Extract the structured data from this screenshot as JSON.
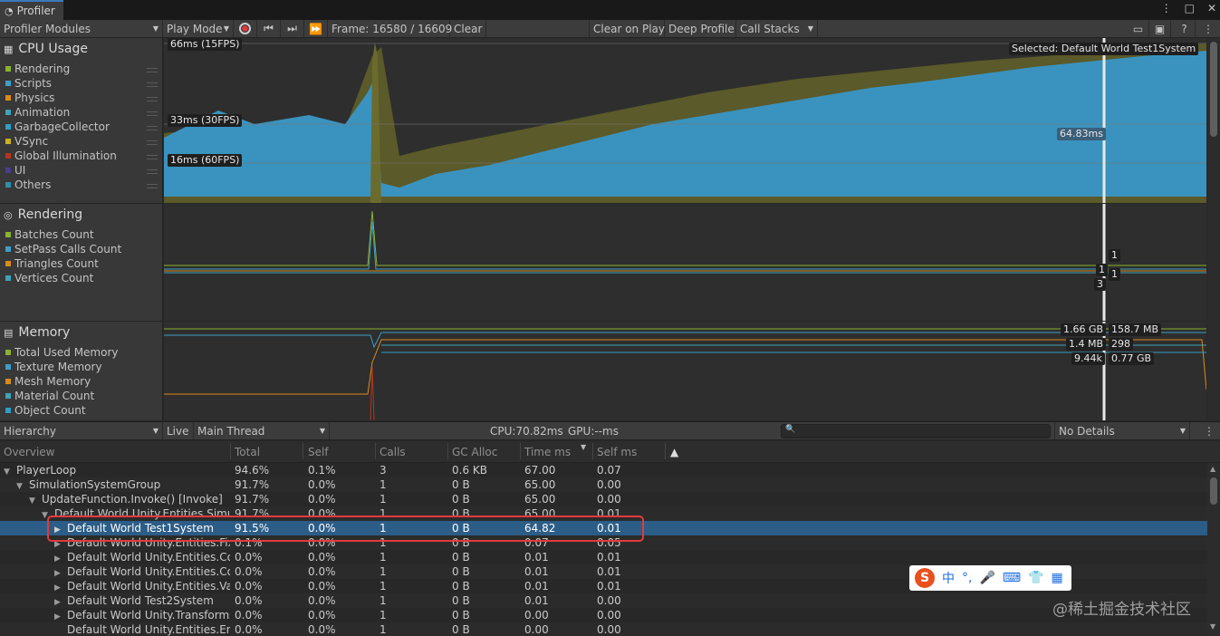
{
  "window": {
    "tab_title": "Profiler"
  },
  "toolbar": {
    "modules_label": "Profiler Modules",
    "play_mode_label": "Play Mode",
    "frame_label": "Frame: 16580 / 16609",
    "clear_label": "Clear",
    "clear_on_play_label": "Clear on Play",
    "deep_profile_label": "Deep Profile",
    "call_stacks_label": "Call Stacks"
  },
  "modules": [
    {
      "title": "CPU Usage",
      "items": [
        {
          "label": "Rendering",
          "color": "#8bb22e"
        },
        {
          "label": "Scripts",
          "color": "#3e9ec7"
        },
        {
          "label": "Physics",
          "color": "#d98b1a"
        },
        {
          "label": "Animation",
          "color": "#3ea3b8"
        },
        {
          "label": "GarbageCollector",
          "color": "#2e9ec4"
        },
        {
          "label": "VSync",
          "color": "#c8b21f"
        },
        {
          "label": "Global Illumination",
          "color": "#b5341f"
        },
        {
          "label": "UI",
          "color": "#4a3d8f"
        },
        {
          "label": "Others",
          "color": "#2f8fa8"
        }
      ]
    },
    {
      "title": "Rendering",
      "items": [
        {
          "label": "Batches Count",
          "color": "#8bb22e"
        },
        {
          "label": "SetPass Calls Count",
          "color": "#3e9ec7"
        },
        {
          "label": "Triangles Count",
          "color": "#d98b1a"
        },
        {
          "label": "Vertices Count",
          "color": "#3ea3b8"
        }
      ]
    },
    {
      "title": "Memory",
      "items": [
        {
          "label": "Total Used Memory",
          "color": "#8bb22e"
        },
        {
          "label": "Texture Memory",
          "color": "#3e9ec7"
        },
        {
          "label": "Mesh Memory",
          "color": "#d98b1a"
        },
        {
          "label": "Material Count",
          "color": "#3ea3b8"
        },
        {
          "label": "Object Count",
          "color": "#2e9ec4"
        }
      ]
    }
  ],
  "cpu_chart": {
    "label_66": "66ms (15FPS)",
    "label_33": "33ms (30FPS)",
    "label_16": "16ms (60FPS)",
    "selected_label": "Selected: Default World Test1System",
    "value_label": "64.83ms"
  },
  "render_chart": {
    "v1": "1",
    "v2": "1",
    "v3": "1",
    "v4": "3"
  },
  "memory_chart": {
    "l1": "1.66 GB",
    "l2": "1.4 MB",
    "l3": "9.44k",
    "r1": "158.7 MB",
    "r2": "298",
    "r3": "0.77 GB"
  },
  "hierarchy": {
    "view_label": "Hierarchy",
    "live_label": "Live",
    "thread_label": "Main Thread",
    "cpu_label": "CPU:70.82ms",
    "gpu_label": "GPU:--ms",
    "details_label": "No Details",
    "columns": [
      "Overview",
      "Total",
      "Self",
      "Calls",
      "GC Alloc",
      "Time ms",
      "Self ms"
    ],
    "rows": [
      {
        "name": "PlayerLoop",
        "indent": 0,
        "arrow": "▼",
        "total": "94.6%",
        "self": "0.1%",
        "calls": "3",
        "gc": "0.6 KB",
        "time": "67.00",
        "selfms": "0.07"
      },
      {
        "name": "SimulationSystemGroup",
        "indent": 1,
        "arrow": "▼",
        "total": "91.7%",
        "self": "0.0%",
        "calls": "1",
        "gc": "0 B",
        "time": "65.00",
        "selfms": "0.00"
      },
      {
        "name": "UpdateFunction.Invoke() [Invoke]",
        "indent": 2,
        "arrow": "▼",
        "total": "91.7%",
        "self": "0.0%",
        "calls": "1",
        "gc": "0 B",
        "time": "65.00",
        "selfms": "0.00"
      },
      {
        "name": "Default World Unity.Entities.Simula",
        "indent": 3,
        "arrow": "▼",
        "total": "91.7%",
        "self": "0.0%",
        "calls": "1",
        "gc": "0 B",
        "time": "65.00",
        "selfms": "0.01"
      },
      {
        "name": "Default World Test1System",
        "indent": 4,
        "arrow": "▶",
        "total": "91.5%",
        "self": "0.0%",
        "calls": "1",
        "gc": "0 B",
        "time": "64.82",
        "selfms": "0.01",
        "selected": true
      },
      {
        "name": "Default World Unity.Entities.Fixe",
        "indent": 4,
        "arrow": "▶",
        "total": "0.1%",
        "self": "0.0%",
        "calls": "1",
        "gc": "0 B",
        "time": "0.07",
        "selfms": "0.05"
      },
      {
        "name": "Default World Unity.Entities.Con",
        "indent": 4,
        "arrow": "▶",
        "total": "0.0%",
        "self": "0.0%",
        "calls": "1",
        "gc": "0 B",
        "time": "0.01",
        "selfms": "0.01"
      },
      {
        "name": "Default World Unity.Entities.Con",
        "indent": 4,
        "arrow": "▶",
        "total": "0.0%",
        "self": "0.0%",
        "calls": "1",
        "gc": "0 B",
        "time": "0.01",
        "selfms": "0.01"
      },
      {
        "name": "Default World Unity.Entities.Vari",
        "indent": 4,
        "arrow": "▶",
        "total": "0.0%",
        "self": "0.0%",
        "calls": "1",
        "gc": "0 B",
        "time": "0.01",
        "selfms": "0.01"
      },
      {
        "name": "Default World Test2System",
        "indent": 4,
        "arrow": "▶",
        "total": "0.0%",
        "self": "0.0%",
        "calls": "1",
        "gc": "0 B",
        "time": "0.01",
        "selfms": "0.00"
      },
      {
        "name": "Default World Unity.Transforms.",
        "indent": 4,
        "arrow": "▶",
        "total": "0.0%",
        "self": "0.0%",
        "calls": "1",
        "gc": "0 B",
        "time": "0.00",
        "selfms": "0.00"
      },
      {
        "name": "Default World Unity.Entities.End",
        "indent": 4,
        "arrow": "",
        "total": "0.0%",
        "self": "0.0%",
        "calls": "1",
        "gc": "0 B",
        "time": "0.00",
        "selfms": "0.00"
      }
    ]
  },
  "ime": {
    "brand": "S",
    "lang": "中"
  },
  "watermark": "@稀土掘金技术社区"
}
